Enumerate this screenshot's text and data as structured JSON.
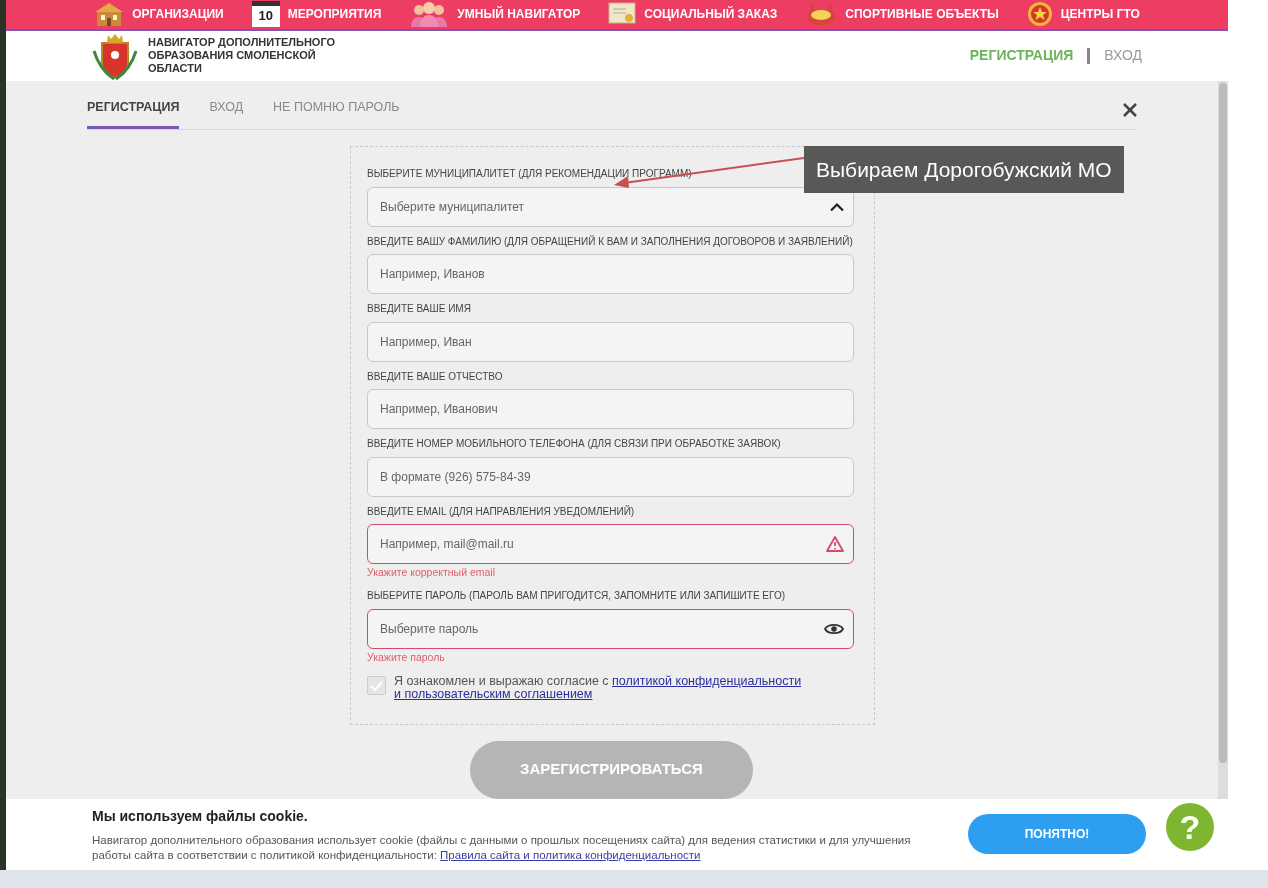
{
  "top_nav": [
    {
      "label": "ОРГАНИЗАЦИИ",
      "kind": "building"
    },
    {
      "label": "МЕРОПРИЯТИЯ",
      "kind": "calendar",
      "icon_text": "10"
    },
    {
      "label": "УМНЫЙ НАВИГАТОР",
      "kind": "people"
    },
    {
      "label": "СОЦИАЛЬНЫЙ ЗАКАЗ",
      "kind": "certificate"
    },
    {
      "label": "СПОРТИВНЫЕ ОБЪЕКТЫ",
      "kind": "stadium"
    },
    {
      "label": "ЦЕНТРЫ ГТО",
      "kind": "emblem"
    }
  ],
  "header": {
    "site_title": "НАВИГАТОР ДОПОЛНИТЕЛЬНОГО ОБРАЗОВАНИЯ СМОЛЕНСКОЙ ОБЛАСТИ",
    "auth_links": [
      {
        "label": "РЕГИСТРАЦИЯ",
        "selected": true
      },
      {
        "label": "ВХОД",
        "selected": false
      }
    ]
  },
  "tabs": [
    {
      "label": "РЕГИСТРАЦИЯ",
      "selected": true
    },
    {
      "label": "ВХОД",
      "selected": false
    },
    {
      "label": "НЕ ПОМНЮ ПАРОЛЬ",
      "selected": false
    }
  ],
  "form": {
    "fields": [
      {
        "kind": "select",
        "label": "ВЫБЕРИТЕ МУНИЦИПАЛИТЕТ (ДЛЯ РЕКОМЕНДАЦИИ ПРОГРАММ)",
        "placeholder": "Выберите муниципалитет",
        "expanded": true,
        "invalid": false
      },
      {
        "kind": "text",
        "label": "ВВЕДИТЕ ВАШУ ФАМИЛИЮ (ДЛЯ ОБРАЩЕНИЙ К ВАМ И ЗАПОЛНЕНИЯ ДОГОВОРОВ И ЗАЯВЛЕНИЙ)",
        "placeholder": "Например, Иванов",
        "invalid": false
      },
      {
        "kind": "text",
        "label": "ВВЕДИТЕ ВАШЕ ИМЯ",
        "placeholder": "Например, Иван",
        "invalid": false
      },
      {
        "kind": "text",
        "label": "ВВЕДИТЕ ВАШЕ ОТЧЕСТВО",
        "placeholder": "Например, Иванович",
        "invalid": false
      },
      {
        "kind": "text",
        "label": "ВВЕДИТЕ НОМЕР МОБИЛЬНОГО ТЕЛЕФОНА (ДЛЯ СВЯЗИ ПРИ ОБРАБОТКЕ ЗАЯВОК)",
        "placeholder": "В формате (926) 575-84-39",
        "invalid": false
      },
      {
        "kind": "text",
        "label": "ВВЕДИТЕ EMAIL (ДЛЯ НАПРАВЛЕНИЯ УВЕДОМЛЕНИЙ)",
        "placeholder": "Например, mail@mail.ru",
        "invalid": true,
        "error": "Укажите корректный email"
      },
      {
        "kind": "password",
        "label": "ВЫБЕРИТЕ ПАРОЛЬ (ПАРОЛЬ ВАМ ПРИГОДИТСЯ, ЗАПОМНИТЕ ИЛИ ЗАПИШИТЕ ЕГО)",
        "placeholder": "Выберите пароль",
        "invalid": true,
        "error": "Укажите пароль"
      }
    ],
    "consent": {
      "text": "Я ознакомлен и выражаю согласие с",
      "link_lines": [
        "политикой конфиденциальности",
        "и пользовательским соглашением"
      ],
      "checked": false
    },
    "submit": {
      "label": "ЗАРЕГИСТРИРОВАТЬСЯ",
      "disabled": true
    }
  },
  "annotation": {
    "text": "Выбираем Дорогобужский МО"
  },
  "cookie_banner": {
    "title": "Мы используем файлы cookie.",
    "text": "Навигатор дополнительного образования использует cookie (файлы с данными о прошлых посещениях сайта) для ведения статистики и для улучшения работы сайта в соответствии с политикой конфиденциальности:",
    "link": "Правила сайта и политика конфиденциальности",
    "button": "ПОНЯТНО!",
    "help_button": "?"
  }
}
